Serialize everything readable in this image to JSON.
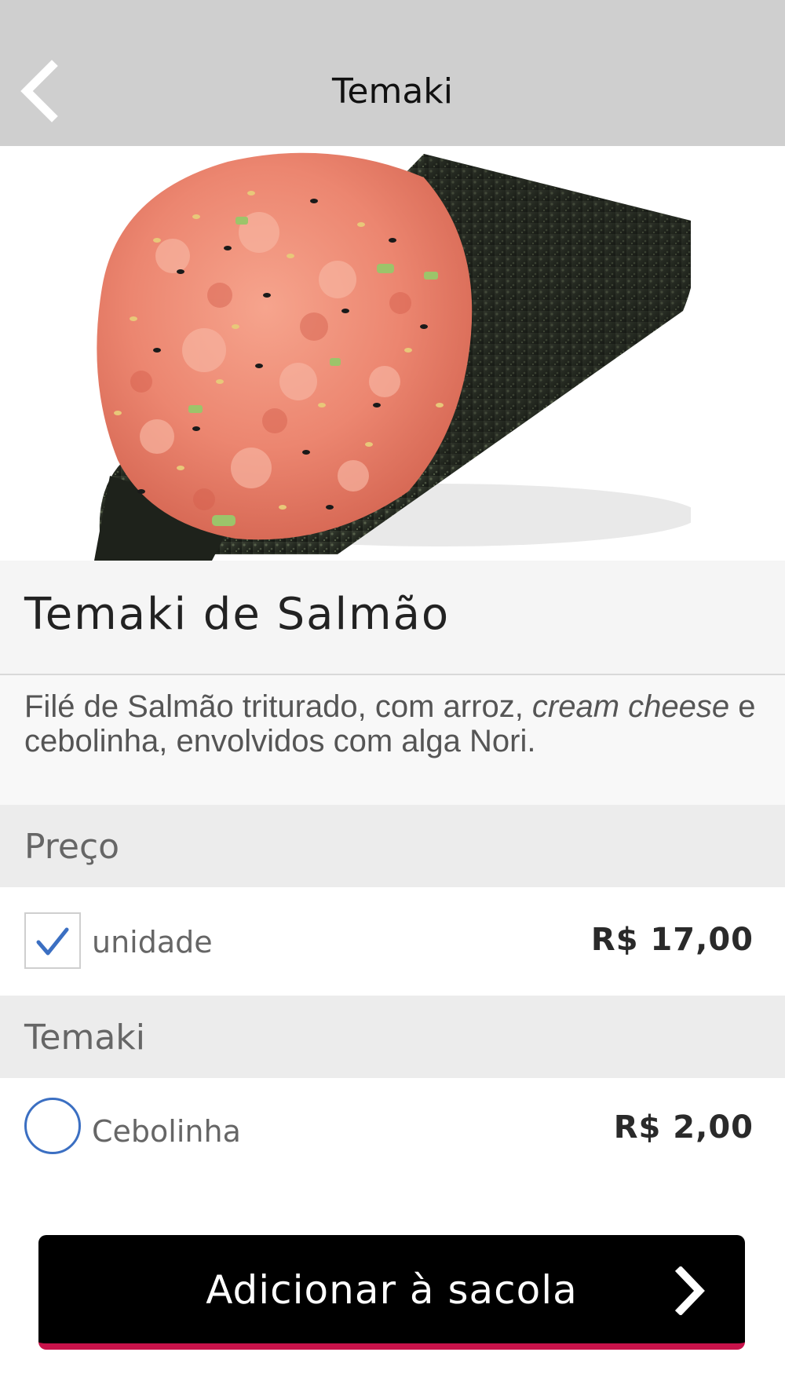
{
  "header": {
    "title": "Temaki",
    "back_icon": "chevron-left-icon"
  },
  "product": {
    "name": "Temaki de Salmão",
    "description_part1": "Filé de Salmão triturado, com arroz, ",
    "description_italic1": "cream cheese",
    "description_part2": " e cebolinha, envolvidos com alga Nori."
  },
  "sections": {
    "price": {
      "title": "Preço",
      "options": [
        {
          "label": "unidade",
          "price": "R$ 17,00",
          "selected": true
        }
      ]
    },
    "temaki": {
      "title": "Temaki",
      "options": [
        {
          "label": "Cebolinha",
          "price": "R$ 2,00",
          "selected": false
        }
      ]
    }
  },
  "cta": {
    "label": "Adicionar à sacola",
    "arrow_icon": "chevron-right-icon"
  },
  "colors": {
    "header_bg": "#cfcfcf",
    "accent_blue": "#3b6fc2",
    "cta_bg": "#000000",
    "cta_underline": "#c8124a"
  }
}
